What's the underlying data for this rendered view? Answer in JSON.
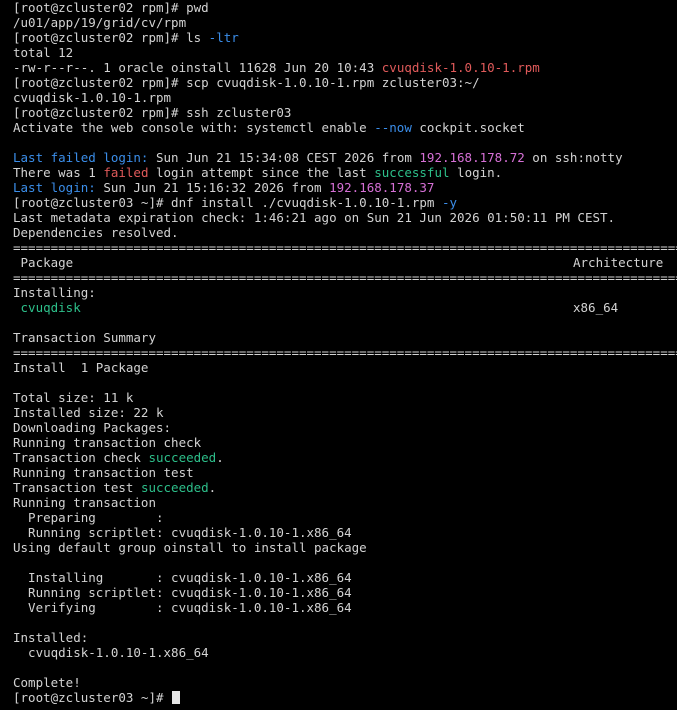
{
  "terminal": {
    "lines": {
      "l1": "[root@zcluster02 rpm]# pwd",
      "l2": "/u01/app/19/grid/cv/rpm",
      "l3_prompt": "[root@zcluster02 rpm]# ls ",
      "l3_opt": "-ltr",
      "l4": "total 12",
      "l5_text": "-rw-r--r--. 1 oracle oinstall 11628 Jun 20 10:43 ",
      "l5_file": "cvuqdisk-1.0.10-1.rpm",
      "l6": "[root@zcluster02 rpm]# scp cvuqdisk-1.0.10-1.rpm zcluster03:~/",
      "l7": "cvuqdisk-1.0.10-1.rpm",
      "l8": "[root@zcluster02 rpm]# ssh zcluster03",
      "l9_a": "Activate the web console with: systemctl enable ",
      "l9_opt": "--now",
      "l9_b": " cockpit.socket",
      "l10": "",
      "l11_label": "Last failed login:",
      "l11_a": " Sun Jun 21 15:34:08 CEST 2026 from ",
      "l11_ip": "192.168.178.72",
      "l11_b": " on ssh:notty",
      "l12_a": "There was 1 ",
      "l12_failed": "failed",
      "l12_b": " login attempt since the last ",
      "l12_success": "successful",
      "l12_c": " login.",
      "l13_label": "Last login:",
      "l13_a": " Sun Jun 21 15:16:32 2026 from ",
      "l13_ip": "192.168.178.37",
      "l14_prompt": "[root@zcluster03 ~]# dnf install ./cvuqdisk-1.0.10-1.rpm ",
      "l14_opt": "-y",
      "l15": "Last metadata expiration check: 1:46:21 ago on Sun 21 Jun 2026 01:50:11 PM CEST.",
      "l16": "Dependencies resolved.",
      "sep1": "================================================================================================",
      "hdr_package": " Package",
      "hdr_arch": "Architecture",
      "sep2": "================================================================================================",
      "l19": "Installing:",
      "pkg_name": " cvuqdisk",
      "pkg_arch": "x86_64",
      "l21": "",
      "l22": "Transaction Summary",
      "sep3": "================================================================================================",
      "l24": "Install  1 Package",
      "l25": "",
      "l26": "Total size: 11 k",
      "l27": "Installed size: 22 k",
      "l28": "Downloading Packages:",
      "l29": "Running transaction check",
      "l30_a": "Transaction check ",
      "l30_ok": "succeeded",
      "l30_b": ".",
      "l31": "Running transaction test",
      "l32_a": "Transaction test ",
      "l32_ok": "succeeded",
      "l32_b": ".",
      "l33": "Running transaction",
      "l34": "  Preparing        :",
      "l35": "  Running scriptlet: cvuqdisk-1.0.10-1.x86_64",
      "l36": "Using default group oinstall to install package",
      "l37": "",
      "l38": "  Installing       : cvuqdisk-1.0.10-1.x86_64",
      "l39": "  Running scriptlet: cvuqdisk-1.0.10-1.x86_64",
      "l40": "  Verifying        : cvuqdisk-1.0.10-1.x86_64",
      "l41": "",
      "l42": "Installed:",
      "l43": "  cvuqdisk-1.0.10-1.x86_64",
      "l44": "",
      "l45": "Complete!",
      "l46_prompt": "[root@zcluster03 ~]# "
    }
  }
}
